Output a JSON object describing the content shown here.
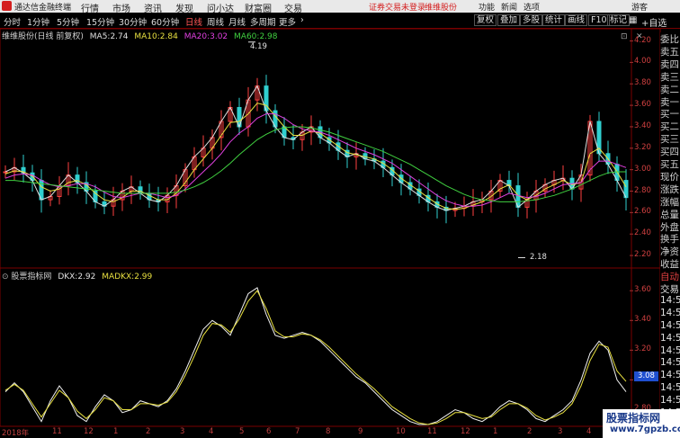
{
  "app": {
    "title": "通达信金融终端",
    "menus": [
      "行情",
      "市场",
      "资讯",
      "发现",
      "问小达",
      "财富圈",
      "交易"
    ],
    "notice": "证券交易未登录",
    "stock_name": "维维股份",
    "right_menus": [
      "功能",
      "新闻",
      "选项",
      "游客"
    ]
  },
  "toolbar": {
    "periods": [
      "分时",
      "1分钟",
      "5分钟",
      "15分钟",
      "30分钟",
      "60分钟",
      "日线",
      "周线",
      "月线",
      "多周期",
      "更多"
    ],
    "active_period": "日线",
    "buttons": [
      "复权",
      "叠加",
      "多股",
      "统计",
      "画线",
      "F10",
      "标记"
    ],
    "more_arrow": "›",
    "icons": [
      "grid-icon",
      "close-icon"
    ],
    "compare_btn": "+自选"
  },
  "price_panel": {
    "title": "维维股份(日线 前复权)",
    "ma": [
      {
        "label": "MA5:",
        "value": "2.74",
        "color": "#e0e0e0"
      },
      {
        "label": "MA10:",
        "value": "2.84",
        "color": "#e8e040"
      },
      {
        "label": "MA20:",
        "value": "3.02",
        "color": "#e040e0"
      },
      {
        "label": "MA60:",
        "value": "2.98",
        "color": "#40d040"
      }
    ],
    "y_ticks": [
      "4.20",
      "4.00",
      "3.80",
      "3.60",
      "3.40",
      "3.20",
      "3.00",
      "2.80",
      "2.60",
      "2.40",
      "2.20"
    ],
    "high_label": "4.19",
    "low_label": "2.18"
  },
  "indicator_panel": {
    "title": "股票指标网",
    "dkx_label": "DKX:",
    "dkx_value": "2.92",
    "madkx_label": "MADKX:",
    "madkx_value": "2.99",
    "y_ticks": [
      "3.60",
      "3.40",
      "3.20",
      "3.00",
      "2.80"
    ],
    "highlight": "3.08"
  },
  "x_axis": [
    "2018年",
    "11",
    "12",
    "1",
    "2",
    "3",
    "4",
    "5",
    "6",
    "7",
    "8",
    "9",
    "10",
    "11",
    "12",
    "1",
    "2",
    "3",
    "4"
  ],
  "side_labels": [
    "委比",
    "卖五",
    "卖四",
    "卖三",
    "卖二",
    "卖一",
    "买一",
    "买二",
    "买三",
    "买四",
    "买五",
    "现价",
    "涨跌",
    "涨幅",
    "总量",
    "外盘",
    "换手",
    "净资",
    "收益",
    "自动",
    "交易",
    "14:5",
    "14:5",
    "14:5",
    "14:5",
    "14:5",
    "14:5",
    "14:5",
    "14:5",
    "14:5",
    "14:5",
    "14:5"
  ],
  "watermark": {
    "line1": "股票指标网",
    "line2": "www.7gpzb.com"
  },
  "chart_data": [
    {
      "type": "line",
      "title": "维维股份(日线 前复权)",
      "series": [
        {
          "name": "MA5",
          "values": [
            2.98,
            3.02,
            2.97,
            2.9,
            2.72,
            2.75,
            2.85,
            2.95,
            2.88,
            2.8,
            2.7,
            2.66,
            2.72,
            2.8,
            2.84,
            2.78,
            2.72,
            2.7,
            2.76,
            2.85,
            3.0,
            3.12,
            3.2,
            3.3,
            3.45,
            3.58,
            3.4,
            3.65,
            3.78,
            3.55,
            3.4,
            3.3,
            3.28,
            3.35,
            3.4,
            3.3,
            3.25,
            3.18,
            3.12,
            3.15,
            3.1,
            3.08,
            3.02,
            2.95,
            2.88,
            2.82,
            2.76,
            2.7,
            2.65,
            2.62,
            2.64,
            2.66,
            2.7,
            2.72,
            2.8,
            2.9,
            2.85,
            2.65,
            2.72,
            2.8,
            2.86,
            2.9,
            2.92,
            2.82,
            2.95,
            3.45,
            3.15,
            3.05,
            2.9,
            2.74
          ]
        },
        {
          "name": "MA10",
          "values": [
            2.96,
            2.99,
            2.98,
            2.94,
            2.84,
            2.8,
            2.82,
            2.88,
            2.9,
            2.86,
            2.78,
            2.72,
            2.7,
            2.74,
            2.8,
            2.8,
            2.76,
            2.72,
            2.72,
            2.78,
            2.88,
            3.0,
            3.1,
            3.2,
            3.32,
            3.44,
            3.45,
            3.52,
            3.62,
            3.6,
            3.5,
            3.4,
            3.32,
            3.32,
            3.36,
            3.34,
            3.28,
            3.22,
            3.16,
            3.14,
            3.12,
            3.1,
            3.06,
            3.0,
            2.92,
            2.86,
            2.8,
            2.74,
            2.68,
            2.64,
            2.63,
            2.64,
            2.67,
            2.7,
            2.75,
            2.82,
            2.86,
            2.76,
            2.72,
            2.76,
            2.82,
            2.86,
            2.9,
            2.86,
            2.88,
            3.15,
            3.2,
            3.1,
            2.98,
            2.84
          ]
        },
        {
          "name": "MA20",
          "values": [
            2.92,
            2.95,
            2.96,
            2.95,
            2.9,
            2.86,
            2.84,
            2.85,
            2.87,
            2.87,
            2.84,
            2.79,
            2.75,
            2.74,
            2.76,
            2.78,
            2.78,
            2.76,
            2.74,
            2.76,
            2.82,
            2.9,
            2.98,
            3.06,
            3.15,
            3.26,
            3.34,
            3.4,
            3.48,
            3.52,
            3.52,
            3.48,
            3.42,
            3.38,
            3.36,
            3.35,
            3.32,
            3.28,
            3.24,
            3.2,
            3.17,
            3.14,
            3.1,
            3.06,
            3.0,
            2.94,
            2.88,
            2.82,
            2.76,
            2.71,
            2.68,
            2.66,
            2.66,
            2.67,
            2.7,
            2.74,
            2.78,
            2.76,
            2.74,
            2.75,
            2.78,
            2.82,
            2.86,
            2.87,
            2.88,
            3.0,
            3.08,
            3.08,
            3.05,
            3.02
          ]
        },
        {
          "name": "MA60",
          "values": [
            2.9,
            2.9,
            2.89,
            2.88,
            2.87,
            2.86,
            2.85,
            2.84,
            2.83,
            2.82,
            2.81,
            2.8,
            2.79,
            2.78,
            2.78,
            2.78,
            2.78,
            2.78,
            2.78,
            2.79,
            2.81,
            2.84,
            2.88,
            2.93,
            2.99,
            3.06,
            3.14,
            3.21,
            3.28,
            3.33,
            3.37,
            3.39,
            3.4,
            3.4,
            3.39,
            3.37,
            3.35,
            3.32,
            3.29,
            3.26,
            3.23,
            3.2,
            3.17,
            3.13,
            3.09,
            3.05,
            3.0,
            2.95,
            2.9,
            2.85,
            2.81,
            2.77,
            2.74,
            2.72,
            2.71,
            2.7,
            2.7,
            2.7,
            2.71,
            2.72,
            2.74,
            2.76,
            2.79,
            2.82,
            2.86,
            2.9,
            2.94,
            2.97,
            2.98,
            2.98
          ]
        }
      ],
      "ylim": [
        2.1,
        4.28
      ]
    },
    {
      "type": "line",
      "title": "股票指标网",
      "series": [
        {
          "name": "DKX",
          "values": [
            2.92,
            2.98,
            2.92,
            2.82,
            2.72,
            2.86,
            2.96,
            2.88,
            2.76,
            2.72,
            2.82,
            2.9,
            2.86,
            2.78,
            2.8,
            2.86,
            2.84,
            2.82,
            2.86,
            2.94,
            3.06,
            3.2,
            3.34,
            3.4,
            3.36,
            3.3,
            3.44,
            3.58,
            3.62,
            3.44,
            3.3,
            3.28,
            3.3,
            3.32,
            3.3,
            3.26,
            3.2,
            3.14,
            3.08,
            3.02,
            2.98,
            2.92,
            2.86,
            2.8,
            2.76,
            2.72,
            2.7,
            2.7,
            2.72,
            2.76,
            2.8,
            2.78,
            2.74,
            2.72,
            2.76,
            2.82,
            2.86,
            2.84,
            2.8,
            2.74,
            2.72,
            2.76,
            2.8,
            2.86,
            3.0,
            3.18,
            3.26,
            3.2,
            3.0,
            2.92
          ]
        },
        {
          "name": "MADKX",
          "values": [
            2.93,
            2.97,
            2.93,
            2.84,
            2.75,
            2.84,
            2.93,
            2.88,
            2.79,
            2.74,
            2.8,
            2.88,
            2.86,
            2.8,
            2.8,
            2.84,
            2.84,
            2.83,
            2.85,
            2.92,
            3.03,
            3.16,
            3.3,
            3.38,
            3.37,
            3.32,
            3.41,
            3.53,
            3.6,
            3.48,
            3.33,
            3.29,
            3.29,
            3.31,
            3.3,
            3.27,
            3.22,
            3.16,
            3.1,
            3.04,
            2.99,
            2.94,
            2.88,
            2.82,
            2.78,
            2.74,
            2.71,
            2.7,
            2.71,
            2.74,
            2.78,
            2.78,
            2.76,
            2.74,
            2.75,
            2.8,
            2.84,
            2.84,
            2.81,
            2.76,
            2.73,
            2.75,
            2.78,
            2.84,
            2.96,
            3.13,
            3.24,
            3.22,
            3.06,
            2.99
          ]
        }
      ],
      "ylim": [
        2.7,
        3.68
      ]
    }
  ]
}
